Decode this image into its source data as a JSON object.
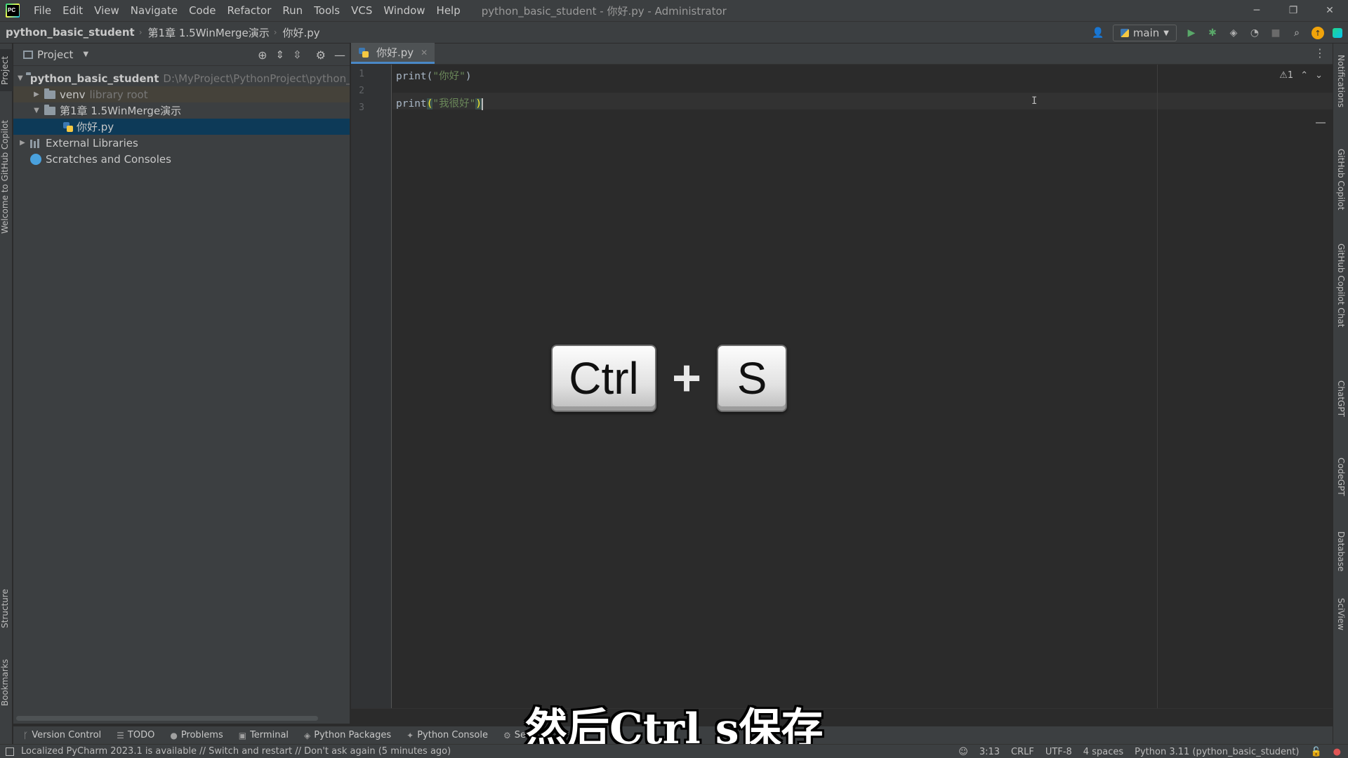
{
  "titlebar": {
    "menu": [
      "File",
      "Edit",
      "View",
      "Navigate",
      "Code",
      "Refactor",
      "Run",
      "Tools",
      "VCS",
      "Window",
      "Help"
    ],
    "title": "python_basic_student - 你好.py - Administrator",
    "minimize": "─",
    "restore": "❐",
    "close": "✕"
  },
  "navbar": {
    "crumbs": [
      "python_basic_student",
      "第1章 1.5WinMerge演示",
      "你好.py"
    ],
    "run_config": "main"
  },
  "left_strip": {
    "project": "Project",
    "copilot_welcome": "Welcome to GitHub Copilot",
    "structure": "Structure",
    "bookmarks": "Bookmarks"
  },
  "right_strip": {
    "notifications": "Notifications",
    "copilot": "GitHub Copilot",
    "copilot_chat": "GitHub Copilot Chat",
    "chatgpt": "ChatGPT",
    "codegpt": "CodeGPT",
    "database": "Database",
    "sciview": "SciView"
  },
  "project_panel": {
    "title": "Project",
    "tree": {
      "root_name": "python_basic_student",
      "root_path": "D:\\MyProject\\PythonProject\\python_basic_",
      "venv": "venv",
      "venv_note": "library root",
      "chapter": "第1章 1.5WinMerge演示",
      "file": "你好.py",
      "external": "External Libraries",
      "scratches": "Scratches and Consoles"
    }
  },
  "editor": {
    "tab_label": "你好.py",
    "line_numbers": [
      "1",
      "2",
      "3"
    ],
    "line1_fn": "print(",
    "line1_str": "\"你好\"",
    "line1_end": ")",
    "line3_fn": "print",
    "line3_open": "(",
    "line3_str": "\"我很好\"",
    "line3_close": ")",
    "warning_count": "⚠1"
  },
  "overlay": {
    "key1": "Ctrl",
    "plus": "+",
    "key2": "S"
  },
  "subtitle": "然后Ctrl s保存",
  "tool_windows": [
    "Version Control",
    "TODO",
    "Problems",
    "Terminal",
    "Python Packages",
    "Python Console",
    "Ser"
  ],
  "statusbar": {
    "message": "Localized PyCharm 2023.1 is available // Switch and restart // Don't ask again (5 minutes ago)",
    "position": "3:13",
    "line_sep": "CRLF",
    "encoding": "UTF-8",
    "indent": "4 spaces",
    "interpreter": "Python 3.11 (python_basic_student)"
  },
  "colors": {
    "accent": "#4a88c7",
    "selection": "#0d3a58",
    "string": "#6a8759",
    "bracket_match": "#ffef28"
  }
}
